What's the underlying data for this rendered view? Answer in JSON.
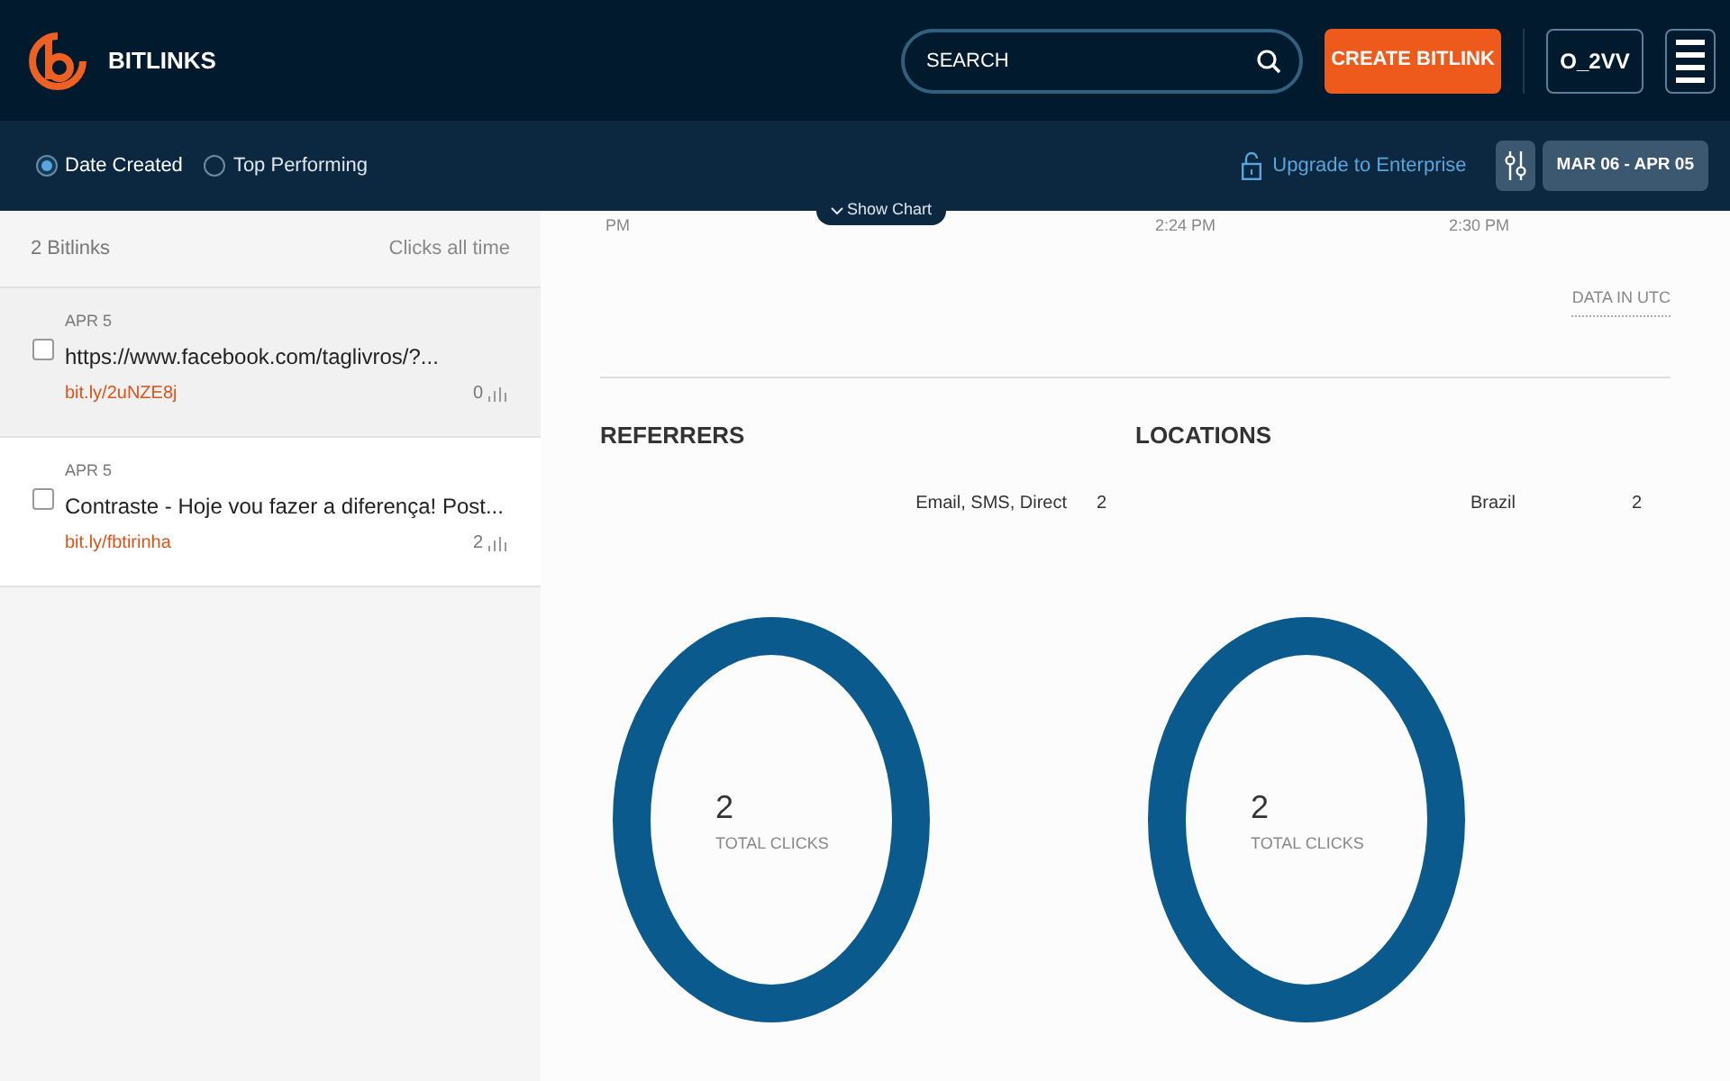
{
  "header": {
    "title": "BITLINKS",
    "search": {
      "placeholder": "SEARCH"
    },
    "create_button": "CREATE BITLINK",
    "account": "O_2VV"
  },
  "sort_options": [
    {
      "label": "Date Created",
      "selected": true
    },
    {
      "label": "Top Performing",
      "selected": false
    }
  ],
  "upgrade_link": "Upgrade to Enterprise",
  "date_range": "MAR 06 - APR 05",
  "show_chart": "Show Chart",
  "list": {
    "count": "2 Bitlinks",
    "clicks_heading": "Clicks all time",
    "items": [
      {
        "date": "APR 5",
        "title": "https://www.facebook.com/taglivros/?...",
        "short_link": "bit.ly/2uNZE8j",
        "clicks": "0",
        "checked": false,
        "selected": true
      },
      {
        "date": "APR 5",
        "title": "Contraste - Hoje vou fazer a diferença! Post...",
        "short_link": "bit.ly/fbtirinha",
        "clicks": "2",
        "checked": false,
        "selected": false
      }
    ]
  },
  "time_axis": [
    "PM",
    "2:24 PM",
    "2:30 PM"
  ],
  "data_note": "DATA IN UTC",
  "panels": [
    {
      "title": "REFERRERS",
      "rows": [
        {
          "label": "Email, SMS, Direct",
          "value": "2"
        }
      ],
      "total": "2",
      "total_label": "TOTAL CLICKS"
    },
    {
      "title": "LOCATIONS",
      "rows": [
        {
          "label": "Brazil",
          "value": "2"
        }
      ],
      "total": "2",
      "total_label": "TOTAL CLICKS"
    }
  ]
}
